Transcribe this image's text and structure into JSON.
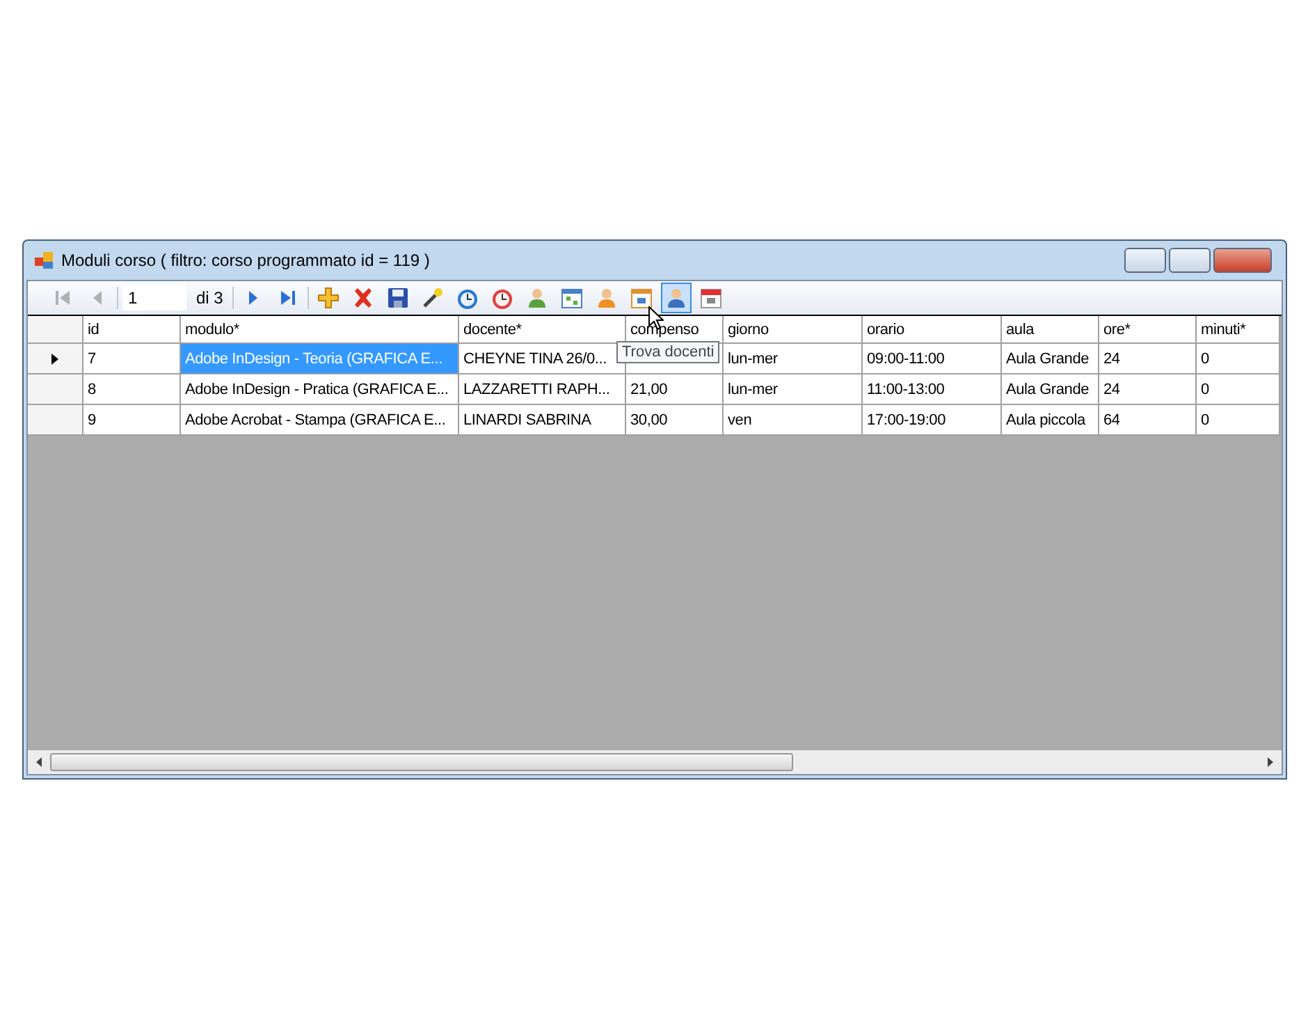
{
  "window": {
    "title": "Moduli corso ( filtro: corso programmato id = 119 )"
  },
  "toolbar": {
    "items": [
      {
        "kind": "first",
        "disabled": true,
        "hovered": false
      },
      {
        "kind": "prev",
        "disabled": true,
        "hovered": false
      },
      {
        "kind": "position",
        "value": "1"
      },
      {
        "kind": "count",
        "text": "di 3"
      },
      {
        "kind": "next",
        "disabled": false,
        "hovered": false
      },
      {
        "kind": "last",
        "disabled": false,
        "hovered": false
      },
      {
        "kind": "add",
        "hovered": false
      },
      {
        "kind": "delete",
        "hovered": false
      },
      {
        "kind": "save",
        "hovered": false
      },
      {
        "kind": "wand",
        "hovered": false
      },
      {
        "kind": "clock",
        "hovered": false
      },
      {
        "kind": "alarm",
        "hovered": false
      },
      {
        "kind": "person-green",
        "hovered": false
      },
      {
        "kind": "calendar-grid",
        "hovered": false
      },
      {
        "kind": "person-orange",
        "hovered": false
      },
      {
        "kind": "calendar-10",
        "hovered": false
      },
      {
        "kind": "person-blue",
        "hovered": true
      },
      {
        "kind": "calendar-17",
        "hovered": false
      }
    ]
  },
  "tooltip": {
    "text": "Trova docenti"
  },
  "table": {
    "columns": [
      "id",
      "modulo*",
      "docente*",
      "compenso",
      "giorno",
      "orario",
      "aula",
      "ore*",
      "minuti*"
    ],
    "rows": [
      {
        "current": true,
        "cells": [
          {
            "text": "7",
            "selected": false
          },
          {
            "text": "Adobe InDesign - Teoria (GRAFICA E...",
            "selected": true
          },
          {
            "text": "CHEYNE TINA 26/0...",
            "selected": false
          },
          {
            "selected": false
          },
          {
            "text": "lun-mer",
            "selected": false
          },
          {
            "text": "09:00-11:00",
            "selected": false
          },
          {
            "text": "Aula Grande",
            "selected": false
          },
          {
            "text": "24",
            "selected": false
          },
          {
            "text": "0",
            "selected": false
          }
        ]
      },
      {
        "current": false,
        "cells": [
          {
            "text": "8",
            "selected": false
          },
          {
            "text": "Adobe InDesign - Pratica (GRAFICA E...",
            "selected": false
          },
          {
            "text": "LAZZARETTI RAPH...",
            "selected": false
          },
          {
            "text": "21,00",
            "selected": false
          },
          {
            "text": "lun-mer",
            "selected": false
          },
          {
            "text": "11:00-13:00",
            "selected": false
          },
          {
            "text": "Aula Grande",
            "selected": false
          },
          {
            "text": "24",
            "selected": false
          },
          {
            "text": "0",
            "selected": false
          }
        ]
      },
      {
        "current": false,
        "cells": [
          {
            "text": "9",
            "selected": false
          },
          {
            "text": "Adobe Acrobat - Stampa (GRAFICA E...",
            "selected": false
          },
          {
            "text": "LINARDI SABRINA",
            "selected": false
          },
          {
            "text": "30,00",
            "selected": false
          },
          {
            "text": "ven",
            "selected": false
          },
          {
            "text": "17:00-19:00",
            "selected": false
          },
          {
            "text": "Aula piccola",
            "selected": false
          },
          {
            "text": "64",
            "selected": false
          },
          {
            "text": "0",
            "selected": false
          }
        ]
      }
    ]
  }
}
